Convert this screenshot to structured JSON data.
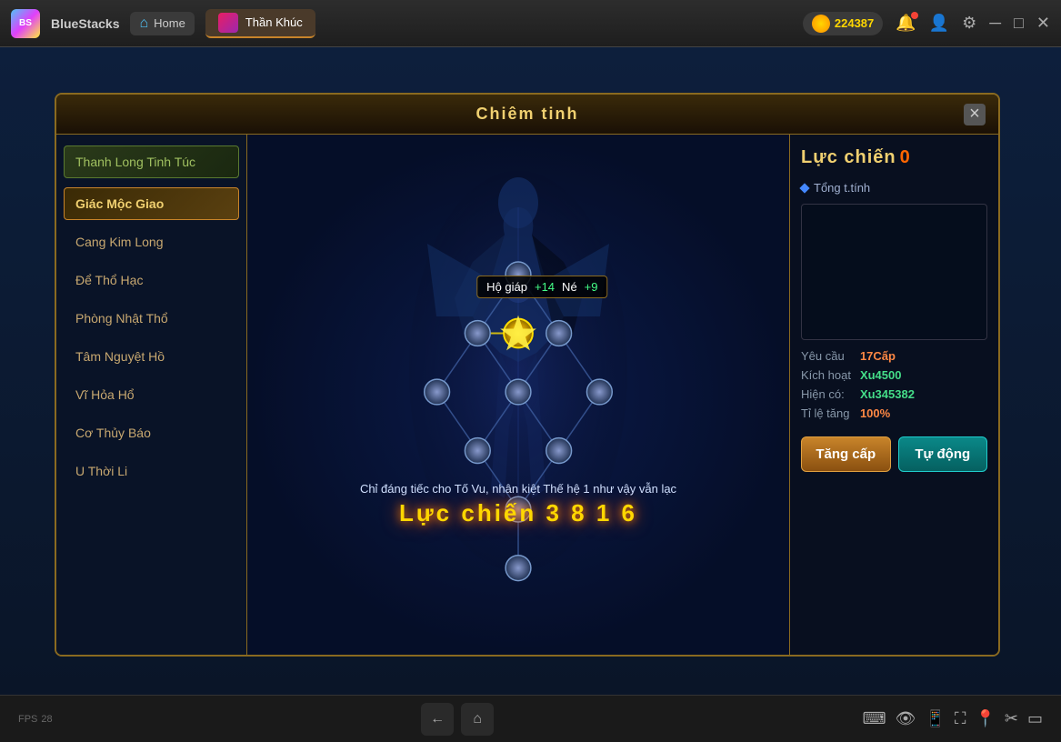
{
  "topbar": {
    "app_name": "BlueStacks",
    "home_label": "Home",
    "tab_title": "Thần Khúc",
    "coin_amount": "224387",
    "close_label": "×"
  },
  "dialog": {
    "title": "Chiêm tinh",
    "close_label": "×",
    "top_button": "Thanh Long Tinh Túc",
    "sidebar_items": [
      {
        "label": "Giác Mộc Giao",
        "active": true
      },
      {
        "label": "Cang Kim Long",
        "active": false
      },
      {
        "label": "Để Thổ Hạc",
        "active": false
      },
      {
        "label": "Phòng Nhật Thổ",
        "active": false
      },
      {
        "label": "Tâm Nguyệt Hồ",
        "active": false
      },
      {
        "label": "Vĩ Hỏa Hổ",
        "active": false
      },
      {
        "label": "Cơ Thủy Báo",
        "active": false
      },
      {
        "label": "U Thời Li",
        "active": false
      }
    ],
    "tooltip": {
      "stat1_label": "Hộ giáp",
      "stat1_value": "+14",
      "stat2_label": "Né",
      "stat2_value": "+9"
    },
    "desc_text": "Chỉ đáng tiếc cho Tố Vu, nhân kiệt Thế hệ 1 như vậy vẫn lạc",
    "power_text": "Lực chiến 3 8 1 6",
    "right_panel": {
      "title": "Lực chiến",
      "power_value": "0",
      "section_label": "Tổng t.tính",
      "yeu_cau_label": "Yêu cầu",
      "yeu_cau_value": "17Cấp",
      "kich_hoat_label": "Kích hoạt",
      "kich_hoat_value": "Xu4500",
      "hien_co_label": "Hiện có:",
      "hien_co_value": "Xu345382",
      "ti_le_label": "Tỉ lệ tăng",
      "ti_le_value": "100%",
      "btn_tang_cap": "Tăng cấp",
      "btn_tu_dong": "Tự động"
    }
  },
  "bottom": {
    "fps_label": "FPS",
    "fps_value": "28"
  }
}
